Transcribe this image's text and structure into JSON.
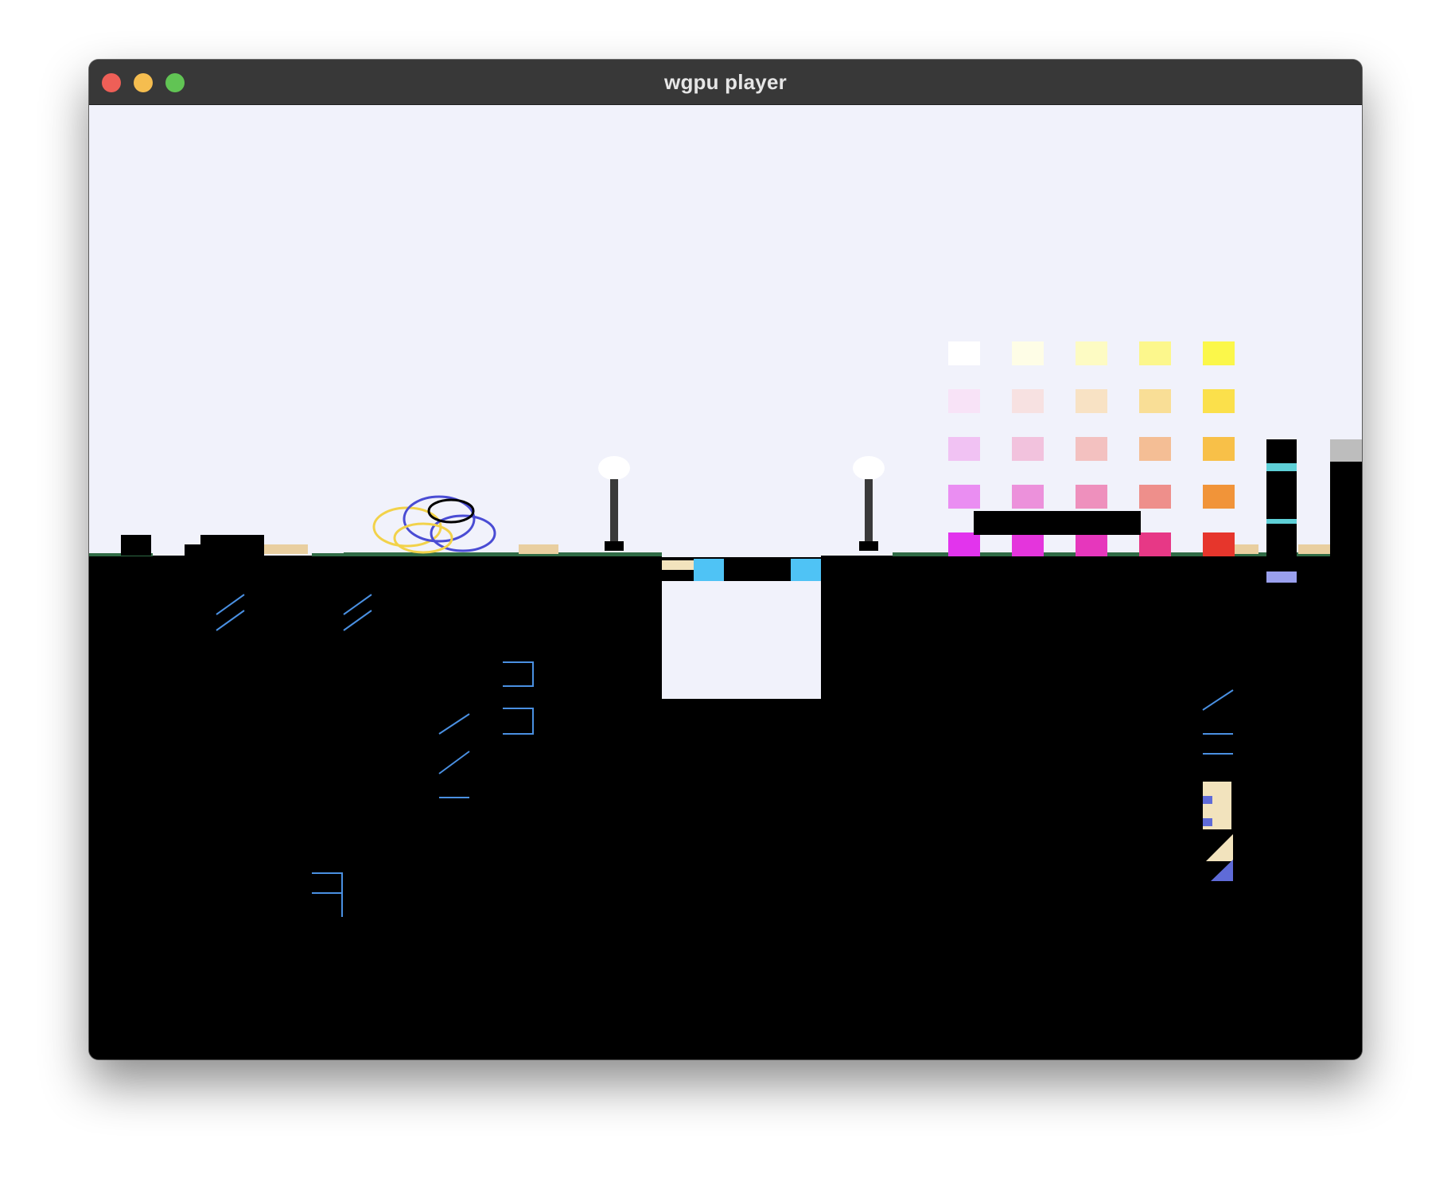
{
  "window": {
    "title": "wgpu player",
    "buttons": [
      {
        "name": "close",
        "color": "#ee5f57"
      },
      {
        "name": "minimize",
        "color": "#f5bd4f"
      },
      {
        "name": "zoom",
        "color": "#61c454"
      }
    ]
  },
  "scene": {
    "sky_color": "#f1f2fb",
    "ground_color": "#000000",
    "palette_rows": [
      [
        "#ffffff",
        "#fefde6",
        "#fdfbc3",
        "#fcf78c",
        "#fbf74a"
      ],
      [
        "#f8e3f7",
        "#f7e1e1",
        "#f8e2c4",
        "#f9de96",
        "#fbe04b"
      ],
      [
        "#f1c2f3",
        "#f2c2dd",
        "#f3c1c0",
        "#f4be95",
        "#f8c048"
      ],
      [
        "#ea8ef2",
        "#ec91db",
        "#ee90bd",
        "#ee8f8b",
        "#f19439"
      ],
      [
        "#e234ed",
        "#e435dc",
        "#e637bc",
        "#e73886",
        "#e6362c"
      ]
    ]
  }
}
